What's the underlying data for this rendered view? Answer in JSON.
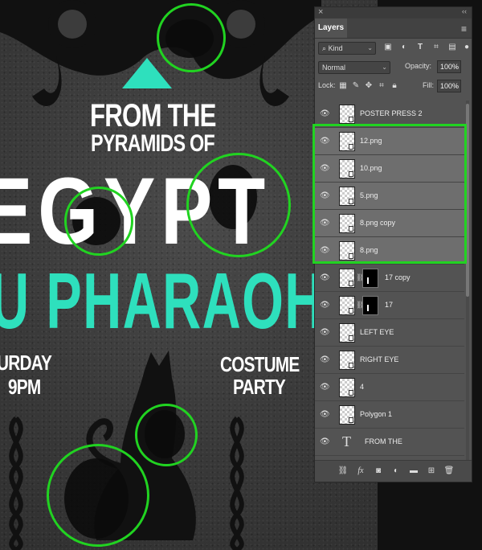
{
  "poster": {
    "line1": "FROM THE",
    "line2": "PYRAMIDS OF",
    "title": "EGYPT",
    "subtitle": "U PHARAOH",
    "date_partial": "URDAY",
    "time": "9PM",
    "event_line1": "COSTUME",
    "event_line2": "PARTY",
    "accent_color": "#2ee0bd"
  },
  "panel": {
    "close_icon": "close-icon",
    "collapse_icon": "double-chevron-icon",
    "tab_label": "Layers",
    "filter": {
      "kind_label": "Kind"
    },
    "blend_mode": "Normal",
    "opacity_label": "Opacity:",
    "opacity_value": "100%",
    "lock_label": "Lock:",
    "fill_label": "Fill:",
    "fill_value": "100%"
  },
  "layers": [
    {
      "name": "POSTER PRESS 2",
      "selected": false
    },
    {
      "name": "12.png",
      "selected": true
    },
    {
      "name": "10.png",
      "selected": true
    },
    {
      "name": "5.png",
      "selected": true
    },
    {
      "name": "8.png copy",
      "selected": true
    },
    {
      "name": "8.png",
      "selected": true
    },
    {
      "name": "17 copy",
      "selected": false,
      "has_mask": true
    },
    {
      "name": "17",
      "selected": false,
      "has_mask": true
    },
    {
      "name": "LEFT EYE",
      "selected": false
    },
    {
      "name": "RIGHT EYE",
      "selected": false
    },
    {
      "name": "4",
      "selected": false
    },
    {
      "name": "Polygon 1",
      "selected": false
    },
    {
      "name": "FROM THE",
      "selected": false,
      "type": "text"
    }
  ],
  "highlight_color": "#21d321"
}
